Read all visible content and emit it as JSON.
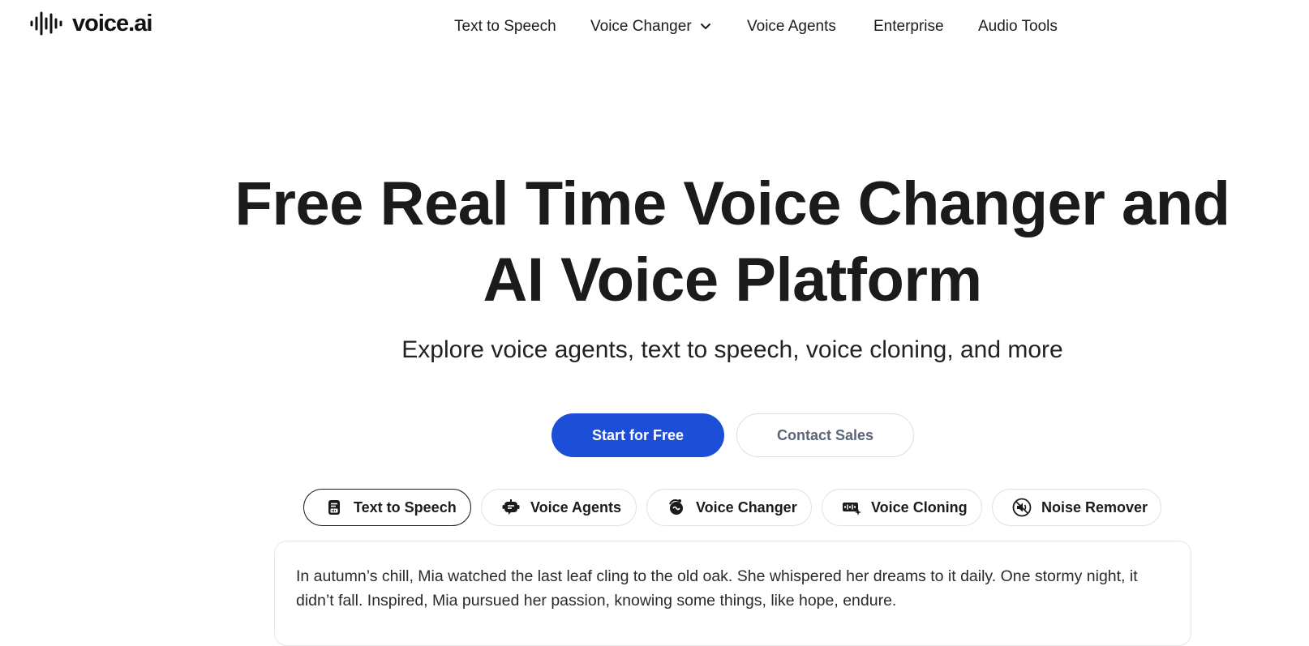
{
  "brand": {
    "name": "voice.ai",
    "logo_icon": "waveform-icon"
  },
  "nav": {
    "items": [
      {
        "label": "Text to Speech"
      },
      {
        "label": "Voice Changer",
        "icon": "chevron-down-icon"
      },
      {
        "label": "Voice Agents"
      },
      {
        "label": "Enterprise"
      },
      {
        "label": "Audio Tools"
      }
    ]
  },
  "hero": {
    "title_line1": "Free Real Time Voice Changer and",
    "title_line2": "AI Voice Platform",
    "subtitle": "Explore voice agents, text to speech, voice cloning, and more"
  },
  "cta": {
    "primary": "Start for Free",
    "secondary": "Contact Sales"
  },
  "tabs": [
    {
      "label": "Text to Speech",
      "icon": "document-audio-icon",
      "active": true
    },
    {
      "label": "Voice Agents",
      "icon": "robot-chat-icon",
      "active": false
    },
    {
      "label": "Voice Changer",
      "icon": "voice-morph-icon",
      "active": false
    },
    {
      "label": "Voice Cloning",
      "icon": "waveform-sparkle-icon",
      "active": false
    },
    {
      "label": "Noise Remover",
      "icon": "speaker-mute-icon",
      "active": false
    }
  ],
  "editor": {
    "text": "In autumn’s chill, Mia watched the last leaf cling to the old oak. She whispered her dreams to it daily. One stormy night, it didn’t fall. Inspired, Mia pursued her passion, knowing some things, like hope, endure."
  },
  "colors": {
    "primary": "#1d4ed8",
    "text": "#1b1b1b",
    "muted": "#5b6478",
    "border": "#e2e2e2"
  }
}
